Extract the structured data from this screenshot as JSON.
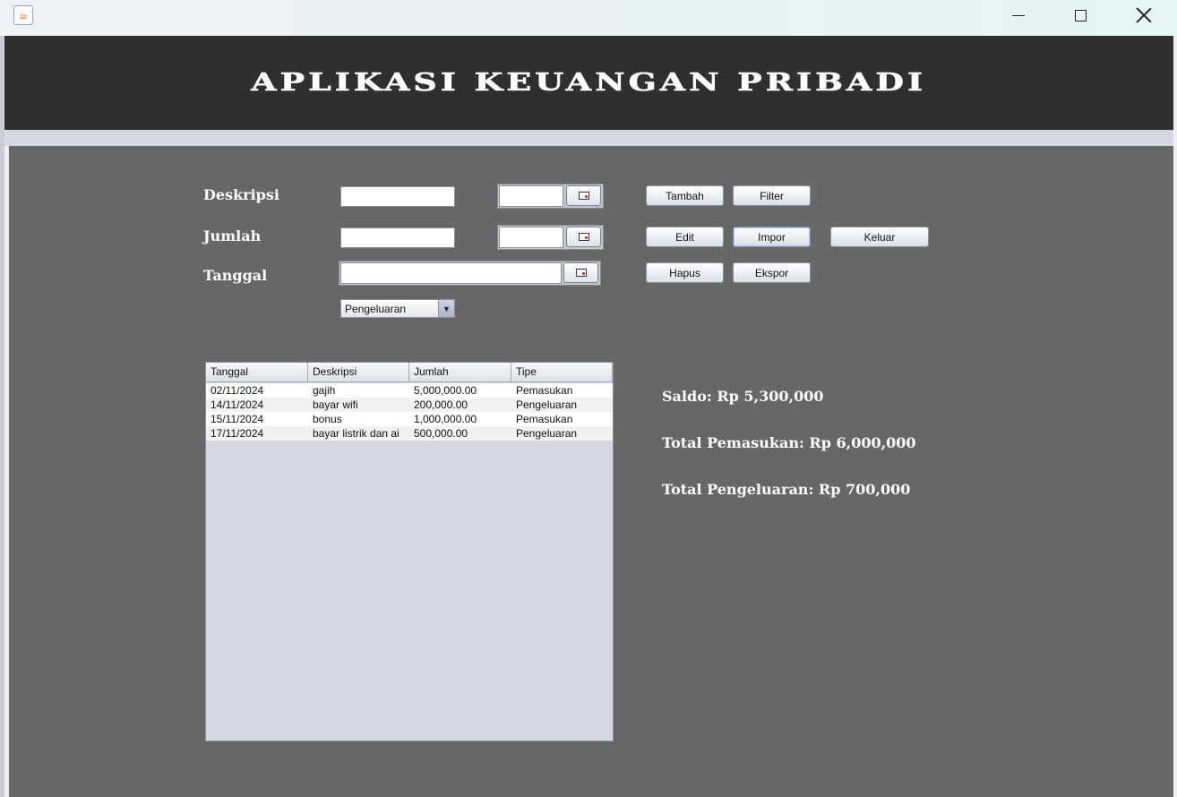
{
  "window": {
    "controls": {
      "minimize": "minimize-icon",
      "maximize": "maximize-icon",
      "close": "close-icon"
    },
    "app_icon": "java-cup-icon"
  },
  "header": {
    "title": "APLIKASI KEUANGAN PRIBADI"
  },
  "form": {
    "deskripsi_label": "Deskripsi",
    "jumlah_label": "Jumlah",
    "tanggal_label": "Tanggal",
    "deskripsi_value": "",
    "jumlah_value": "",
    "tanggal_value": "",
    "filter_date_1": "",
    "filter_date_2": "",
    "tipe_selected": "Pengeluaran"
  },
  "buttons": {
    "tambah": "Tambah",
    "filter": "Filter",
    "edit": "Edit",
    "impor": "Impor",
    "keluar": "Keluar",
    "hapus": "Hapus",
    "ekspor": "Ekspor"
  },
  "table": {
    "columns": [
      "Tanggal",
      "Deskripsi",
      "Jumlah",
      "Tipe"
    ],
    "rows": [
      [
        "02/11/2024",
        "gajih",
        "5,000,000.00",
        "Pemasukan"
      ],
      [
        "14/11/2024",
        "bayar wifi",
        "200,000.00",
        "Pengeluaran"
      ],
      [
        "15/11/2024",
        "bonus",
        "1,000,000.00",
        "Pemasukan"
      ],
      [
        "17/11/2024",
        "bayar listrik dan ai",
        "500,000.00",
        "Pengeluaran"
      ]
    ]
  },
  "summary": {
    "saldo": "Saldo: Rp 5,300,000",
    "total_pemasukan": "Total Pemasukan: Rp 6,000,000",
    "total_pengeluaran": "Total Pengeluaran: Rp 700,000"
  },
  "colors": {
    "header_bg": "#2f2f2f",
    "main_bg": "#676767",
    "table_bg": "#d5d8e0"
  }
}
